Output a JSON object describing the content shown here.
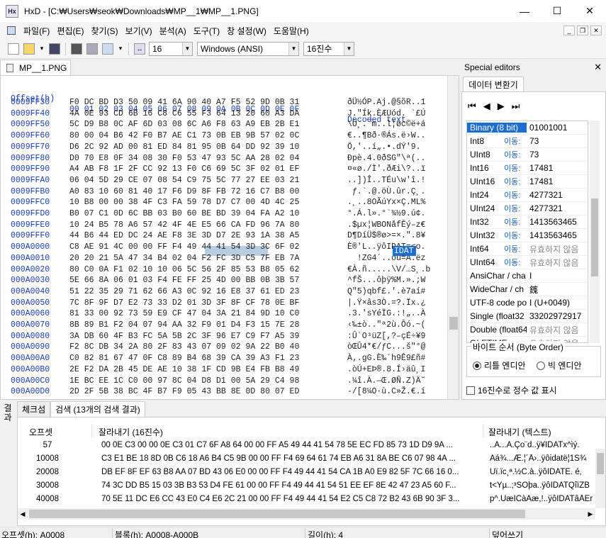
{
  "window": {
    "app": "HxD",
    "path": "[C:₩Users₩seok₩Downloads₩MP__1₩MP__1.PNG]",
    "min": "—",
    "max": "☐",
    "close": "✕"
  },
  "menu": [
    "파일(F)",
    "편집(E)",
    "찾기(S)",
    "보기(V)",
    "분석(A)",
    "도구(T)",
    "창 설정(W)",
    "도움말(H)"
  ],
  "toolbar": {
    "bytes_per_row": "16",
    "charset": "Windows (ANSI)",
    "offset_base": "16진수"
  },
  "doc_tab": "MP__1.PNG",
  "hex": {
    "header": {
      "offset": "Offset(h)",
      "cols": "00 01 02 03 04 05 06 07 08 09 0A 0B 0C 0D 0E 0F",
      "text": "Decoded text"
    },
    "rows": [
      {
        "off": "0009FF30",
        "hex": "F0 DC BD D3 50 09 41 6A 90 40 A7 F5 52 9D 0B 31",
        "txt": "ðÜ½ÓP.Aj.@§õR..1"
      },
      {
        "off": "0009FF40",
        "hex": "4A 0E 93 CD 6B 16 C8 C6 55 F3 64 13 20 60 A3 DA",
        "txt": "J.\"Ík.ÈÆUód. `£Ú"
      },
      {
        "off": "0009FF50",
        "hex": "5C D9 B8 0C AF 6D 03 08 6C A6 F8 63 A9 EB 2B E1",
        "txt": "\\Ù¸.¯m..l¦øc©ë+á"
      },
      {
        "off": "0009FF60",
        "hex": "80 00 04 B6 42 F0 B7 AE C1 73 0B EB 9B 57 02 0C",
        "txt": "€..¶Bð·®Ás.ë›W.."
      },
      {
        "off": "0009FF70",
        "hex": "D6 2C 92 AD 00 81 ED 84 81 95 0B 64 DD 92 39 10",
        "txt": "Ö,'­..í„.•.dÝ'9."
      },
      {
        "off": "0009FF80",
        "hex": "D0 70 E8 0F 34 08 30 F0 53 47 93 5C AA 28 02 04",
        "txt": "Ðpè.4.0ðSG\"\\ª(.."
      },
      {
        "off": "0009FF90",
        "hex": "A4 AB F8 1F 2F CC 92 13 F0 C6 69 5C 3F 02 01 EF",
        "txt": "¤«ø./Ì'.ðÆi\\?..ï"
      },
      {
        "off": "0009FFA0",
        "hex": "06 04 5D 29 CE 07 08 54 C9 75 5C 77 27 EE 03 21",
        "txt": "..])Î..TÉu\\w'î.!"
      },
      {
        "off": "0009FFB0",
        "hex": "A0 83 10 60 81 40 17 F6 D9 8F FB 72 16 C7 B8 00",
        "txt": " ƒ.`.@.öÙ.ûr.Ç¸."
      },
      {
        "off": "0009FFC0",
        "hex": "10 B8 00 00 38 4F C3 FA 59 78 D7 C7 00 4D 4C 25",
        "txt": ".¸..8OÃúYx×Ç.ML%"
      },
      {
        "off": "0009FFD0",
        "hex": "B0 07 C1 0D 6C BB 03 B0 60 BE BD 39 04 FA A2 10",
        "txt": "°.Á.l».°`¾½9.ú¢."
      },
      {
        "off": "0009FFE0",
        "hex": "10 24 B5 78 A6 57 42 4F 4E E5 66 CA FD 96 7A 80",
        "txt": ".$µx¦WBONåfÊý–z€"
      },
      {
        "off": "0009FFF0",
        "hex": "44 B6 44 ED DC 24 AE F8 3E 3D D7 2E 93 1A 38 A5",
        "txt": "D¶DíÜ$®ø>=×.\".8¥"
      },
      {
        "off": "000A0000",
        "hex": "C8 AE 91 4C 00 00 FF F4 49 44 41 54 3D 3C 6F 02",
        "txt": "È®'L..ÿôIDAT=<o."
      },
      {
        "off": "000A0010",
        "hex": "20 20 21 5A 47 34 B4 02 04 F2 FC 3D C5 7F EB 7A",
        "txt": "  !ZG4´..òü=Å.ëz"
      },
      {
        "off": "000A0020",
        "hex": "80 C0 0A F1 02 10 10 06 5C 56 2F 85 53 B8 05 62",
        "txt": "€À.ñ.....\\V/…S¸.b"
      },
      {
        "off": "000A0030",
        "hex": "5E 66 8A 06 01 03 F4 FE FF 25 4D 00 BB 0B 3B 57",
        "txt": "^fŠ...ôþÿ%M.».;W"
      },
      {
        "off": "000A0040",
        "hex": "51 22 35 29 71 62 66 A3 0C 92 16 E8 37 61 ED 23",
        "txt": "Q\"5)qbf£.'.è7aí#"
      },
      {
        "off": "000A0050",
        "hex": "7C 8F 9F D7 E2 73 33 D2 01 3D 3F 8F CF 78 0E BF",
        "txt": "|.Ÿ×âs3Ò.=?.Ïx.¿"
      },
      {
        "off": "000A0060",
        "hex": "81 33 00 92 73 59 E9 CF 47 04 3A 21 84 9D 10 C0",
        "txt": ".3.'sYéÏG.:!„..À"
      },
      {
        "off": "000A0070",
        "hex": "8B 89 B1 F2 04 07 94 AA 32 F9 01 D4 F3 15 7E 28",
        "txt": "‹‰±ò..\"ª2ù.Ôó.~("
      },
      {
        "off": "000A0080",
        "hex": "3A DB 60 4F B3 FC 5A 5B 2C 3F 96 E7 C9 F7 A5 39",
        "txt": ":Û`O³üZ[,?–çÉ÷¥9"
      },
      {
        "off": "000A0090",
        "hex": "F2 8C DB 34 2A 80 2F 83 43 07 09 02 9A 22 B0 40",
        "txt": "òŒÛ4*€/ƒC...š\"°@"
      },
      {
        "off": "000A00A0",
        "hex": "C0 82 81 67 47 0F C8 89 B4 68 39 CA 39 A3 F1 23",
        "txt": "À‚.gG.È‰´h9Ê9£ñ#"
      },
      {
        "off": "000A00B0",
        "hex": "2E F2 DA 2B 45 DE AE 10 38 1F CD 9B E4 FB B8 49",
        "txt": ".òÚ+EÞ®.8.Í›äû¸I"
      },
      {
        "off": "000A00C0",
        "hex": "1E BC EE 1C C0 00 97 8C 04 D8 D1 00 5A 29 C4 98",
        "txt": ".¼î.À.—Œ.ØÑ.Z)Ä˜"
      },
      {
        "off": "000A00D0",
        "hex": "2D 2F 5B 38 BC 4F B7 F9 05 43 BB 8E 0D 80 07 ED",
        "txt": "-/[8¼O·ù.C»Ž.€.í"
      }
    ],
    "selected_text": "IDAT"
  },
  "special_editors": {
    "title": "Special editors",
    "tab": "데이터 변환기",
    "link": "이동:",
    "rows": [
      {
        "label": "Binary (8 bit)",
        "value": "01001001"
      },
      {
        "label": "Int8",
        "value": "73"
      },
      {
        "label": "UInt8",
        "value": "73"
      },
      {
        "label": "Int16",
        "value": "17481"
      },
      {
        "label": "UInt16",
        "value": "17481"
      },
      {
        "label": "Int24",
        "value": "4277321"
      },
      {
        "label": "UInt24",
        "value": "4277321"
      },
      {
        "label": "Int32",
        "value": "1413563465"
      },
      {
        "label": "UInt32",
        "value": "1413563465"
      },
      {
        "label": "Int64",
        "value": "유효하지 않음"
      },
      {
        "label": "UInt64",
        "value": "유효하지 않음"
      },
      {
        "label": "AnsiChar / cha",
        "value": "I"
      },
      {
        "label": "WideChar / ch",
        "value": "䥉"
      },
      {
        "label": "UTF-8 code po",
        "value": "I (U+0049)"
      },
      {
        "label": "Single (float32",
        "value": "33202972917"
      },
      {
        "label": "Double (float64",
        "value": "유효하지 않음"
      },
      {
        "label": "OLETIME",
        "value": "유효하지 않음"
      }
    ],
    "byte_order": {
      "title": "바이트 순서 (Byte Order)",
      "little": "리틀 엔디안",
      "big": "빅 엔디안"
    },
    "hex_int": "16진수로 정수 값 표시"
  },
  "results": {
    "side_label": "결과",
    "tabs": [
      "체크섬",
      "검색 (13개의 검색 결과)"
    ],
    "cols": [
      "오프셋",
      "잘라내기 (16진수)",
      "잘라내기 (텍스트)"
    ],
    "rows": [
      {
        "off": "57",
        "hex": "00 0E C3 00 00 0E C3 01 C7 6F A8 64 00 00 FF A5 49 44 41 54 78 5E EC FD 85 73 1D D9 9A ...",
        "txt": "..Ã...Ã.Ço¨d..ÿ¥IDATx^ìý."
      },
      {
        "off": "10008",
        "hex": "C3 E1 BE 18 8D 0B C6 18 A6 B4 C5 9B 00 00 FF F4 69 64 61 74 EB A6 31 8A BE C6 07 98 4A ...",
        "txt": "Ãá¾...Æ.¦´Å›..ÿôidatë¦1Š¾"
      },
      {
        "off": "20008",
        "hex": "DB EF 8F EF 63 B8 AA 07 BD 43 06 E0 00 00 FF F4 49 44 41 54 CA 1B A0 E9 82 5F 7C 66 16 0...",
        "txt": "Ûï.ïc¸ª.½C.à..ÿôIDATÊ. é‚"
      },
      {
        "off": "30008",
        "hex": "74 3C DD B5 15 03 3B B3 53 D4 FE 61 00 00 FF F4 49 44 41 54 51 EE EF 8E 42 47 23 A5 60 F...",
        "txt": "t<Ýµ..;³SÔþa..ÿôIDATQîïŽB"
      },
      {
        "off": "40008",
        "hex": "70 5E 11 DC E6 CC 43 E0 C4 E6 2C 21 00 00 FF F4 49 44 41 54 E2 C5 C8 72 B2 43 6B 90 3F 3...",
        "txt": "p^.ÜæÌCàÄæ,!..ÿôIDATâÅÈr"
      }
    ]
  },
  "status": {
    "offset": "오프셋(h): A0008",
    "block": "블록(h): A0008-A000B",
    "length": "길이(h): 4",
    "mode": "덮어쓰기"
  }
}
